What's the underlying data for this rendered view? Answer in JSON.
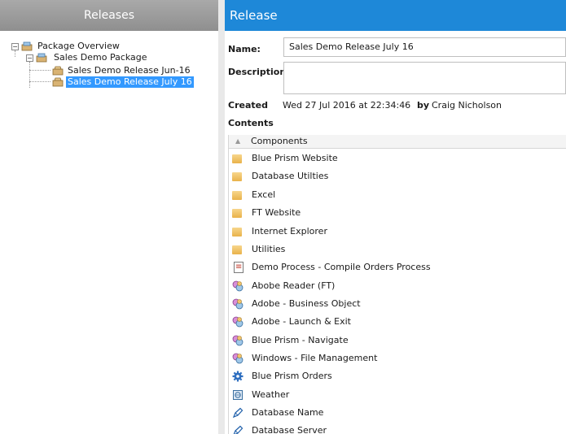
{
  "left_panel": {
    "title": "Releases",
    "tree": [
      {
        "label": "Package Overview"
      },
      {
        "label": "Sales Demo Package"
      },
      {
        "label": "Sales Demo Release Jun-16"
      },
      {
        "label": "Sales Demo Release July 16",
        "selected": true
      }
    ]
  },
  "right_panel": {
    "title": "Release",
    "name_label": "Name:",
    "name_value": "Sales Demo Release July 16",
    "description_label": "Description:",
    "description_value": "",
    "created_label": "Created",
    "created_value": "Wed 27 Jul 2016 at 22:34:46",
    "by_label": "by",
    "by_value": "Craig Nicholson",
    "contents_label": "Contents",
    "column_header": "Components",
    "components": [
      {
        "name": "Blue Prism Website",
        "icon": "folder-icon"
      },
      {
        "name": "Database Utilties",
        "icon": "folder-icon"
      },
      {
        "name": "Excel",
        "icon": "folder-icon"
      },
      {
        "name": "FT Website",
        "icon": "folder-icon"
      },
      {
        "name": "Internet Explorer",
        "icon": "folder-icon"
      },
      {
        "name": "Utilities",
        "icon": "folder-icon"
      },
      {
        "name": "Demo Process - Compile Orders Process",
        "icon": "process-icon"
      },
      {
        "name": "Abobe Reader (FT)",
        "icon": "business-object-icon"
      },
      {
        "name": "Adobe - Business Object",
        "icon": "business-object-icon"
      },
      {
        "name": "Adobe - Launch & Exit",
        "icon": "business-object-icon"
      },
      {
        "name": "Blue Prism - Navigate",
        "icon": "business-object-icon"
      },
      {
        "name": "Windows - File Management",
        "icon": "business-object-icon"
      },
      {
        "name": "Blue Prism Orders",
        "icon": "gear-icon"
      },
      {
        "name": "Weather",
        "icon": "web-service-icon"
      },
      {
        "name": "Database Name",
        "icon": "credential-icon"
      },
      {
        "name": "Database Server",
        "icon": "credential-icon"
      }
    ]
  }
}
